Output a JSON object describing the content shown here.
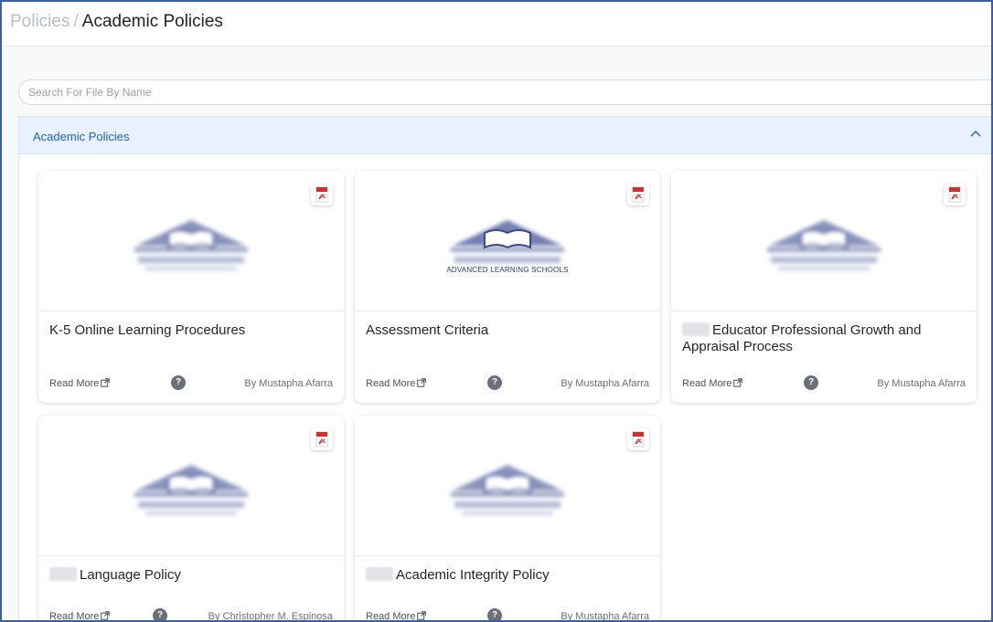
{
  "breadcrumb": {
    "root": "Policies",
    "separator": "/",
    "current": "Academic Policies"
  },
  "search": {
    "placeholder": "Search For File By Name",
    "value": ""
  },
  "section": {
    "title": "Academic Policies",
    "expanded": true
  },
  "cards": [
    {
      "title": "K-5 Online Learning Procedures",
      "redacted_prefix": false,
      "read_more": "Read More",
      "author": "By Mustapha Afarra",
      "file_type": "pdf",
      "logo_caption": ""
    },
    {
      "title": "Assessment Criteria",
      "redacted_prefix": false,
      "read_more": "Read More",
      "author": "By Mustapha Afarra",
      "file_type": "pdf",
      "logo_caption": "ADVANCED LEARNING SCHOOLS"
    },
    {
      "title": "Educator Professional Growth and Appraisal Process",
      "redacted_prefix": true,
      "read_more": "Read More",
      "author": "By Mustapha Afarra",
      "file_type": "pdf",
      "logo_caption": ""
    },
    {
      "title": "Language Policy",
      "redacted_prefix": true,
      "read_more": "Read More",
      "author": "By Christopher M. Espinosa",
      "file_type": "pdf",
      "logo_caption": ""
    },
    {
      "title": "Academic Integrity Policy",
      "redacted_prefix": true,
      "read_more": "Read More",
      "author": "By Mustapha Afarra",
      "file_type": "pdf",
      "logo_caption": ""
    }
  ],
  "help_glyph": "?",
  "colors": {
    "accent": "#1d62c5",
    "section_header_bg": "#e8f1fd",
    "pdf_red": "#d32f2f",
    "logo_navy": "#3a4a8f",
    "frame_border": "#3d5f9e"
  }
}
